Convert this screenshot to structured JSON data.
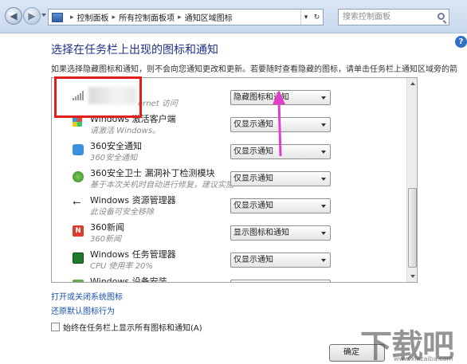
{
  "window": {
    "breadcrumb": [
      "控制面板",
      "所有控制面板项",
      "通知区域图标"
    ],
    "search_placeholder": "搜索控制面板"
  },
  "heading": "选择在任务栏上出现的图标和通知",
  "description": "如果选择隐藏图标和通知，则不会向您通知更改和更新。若要随时查看隐藏的图标，请单击任务栏上通知区域旁的箭头。",
  "rows": [
    {
      "name": "",
      "sub": "ernet 访问",
      "behavior": "隐藏图标和通知",
      "icon": "network-signal-icon"
    },
    {
      "name": "Windows 激活客户端",
      "sub": "请激活 Windows。",
      "behavior": "仅显示通知",
      "icon": "windows-activation-icon"
    },
    {
      "name": "360安全通知",
      "sub": "360安全通知",
      "behavior": "仅显示通知",
      "icon": "chat-bubble-icon"
    },
    {
      "name": "360安全卫士 漏洞补丁检测模块",
      "sub": "基于本次关机时自动进行修复，建议实施",
      "behavior": "仅显示通知",
      "icon": "patch-module-icon"
    },
    {
      "name": "Windows 资源管理器",
      "sub": "此设备可安全移除",
      "behavior": "仅显示通知",
      "icon": "usb-icon"
    },
    {
      "name": "360新闻",
      "sub": "360新闻",
      "behavior": "显示图标和通知",
      "icon": "news-icon"
    },
    {
      "name": "Windows 任务管理器",
      "sub": "CPU 使用率 20%",
      "behavior": "仅显示通知",
      "icon": "task-manager-icon"
    },
    {
      "name": "Windows 设备安装",
      "sub": "",
      "behavior": "",
      "icon": "device-install-icon"
    }
  ],
  "links": {
    "system_icons": "打开或关闭系统图标",
    "restore_defaults": "还原默认图标行为"
  },
  "always_show_label": "始终在任务栏上显示所有图标和通知(A)",
  "ok_button": "确定",
  "watermark": {
    "text": "下载吧",
    "url": "www.xiazaiba.com"
  },
  "colors": {
    "heading": "#1e3287",
    "link": "#1a51b0",
    "highlight": "#e0201a",
    "annotation_arrow": "#e040c8"
  }
}
